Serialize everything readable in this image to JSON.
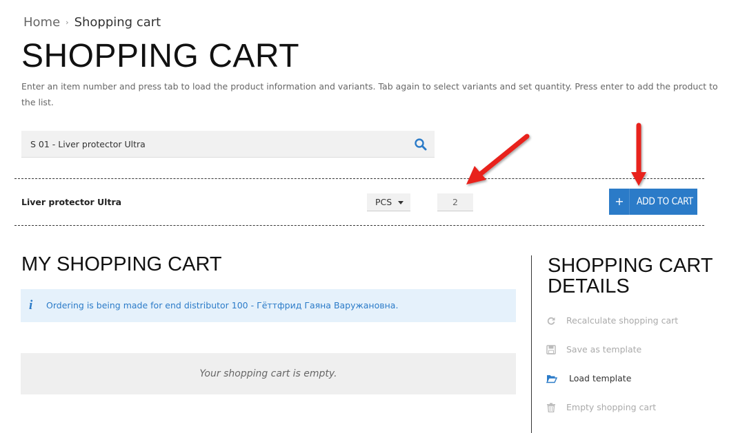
{
  "breadcrumb": {
    "home": "Home",
    "separator": "›",
    "current": "Shopping cart"
  },
  "page": {
    "title": "SHOPPING CART",
    "instructions": "Enter an item number and press tab to load the product information and variants. Tab again to select variants and set quantity. Press enter to add the product to the list."
  },
  "search": {
    "value": "S 01 - Liver protector Ultra",
    "icon": "search-icon"
  },
  "product_row": {
    "name": "Liver protector Ultra",
    "unit": "PCS",
    "quantity": "2",
    "add_button_icon": "+",
    "add_button_label": "ADD TO CART"
  },
  "my_cart": {
    "title": "MY SHOPPING CART",
    "info_icon": "i",
    "info_text": "Ordering is being made for end distributor 100 - Гёттфрид Гаяна Варужановна.",
    "empty_text": "Your shopping cart is empty."
  },
  "details": {
    "title": "SHOPPING CART DETAILS",
    "actions": [
      {
        "label": "Recalculate shopping cart",
        "icon": "refresh-icon",
        "enabled": false
      },
      {
        "label": "Save as template",
        "icon": "save-icon",
        "enabled": false
      },
      {
        "label": "Load template",
        "icon": "folder-open-icon",
        "enabled": true
      },
      {
        "label": "Empty shopping cart",
        "icon": "trash-icon",
        "enabled": false
      }
    ]
  },
  "colors": {
    "accent": "#2b7bc8",
    "info_bg": "#e5f1fb",
    "annotation_arrow": "#e8231f"
  }
}
